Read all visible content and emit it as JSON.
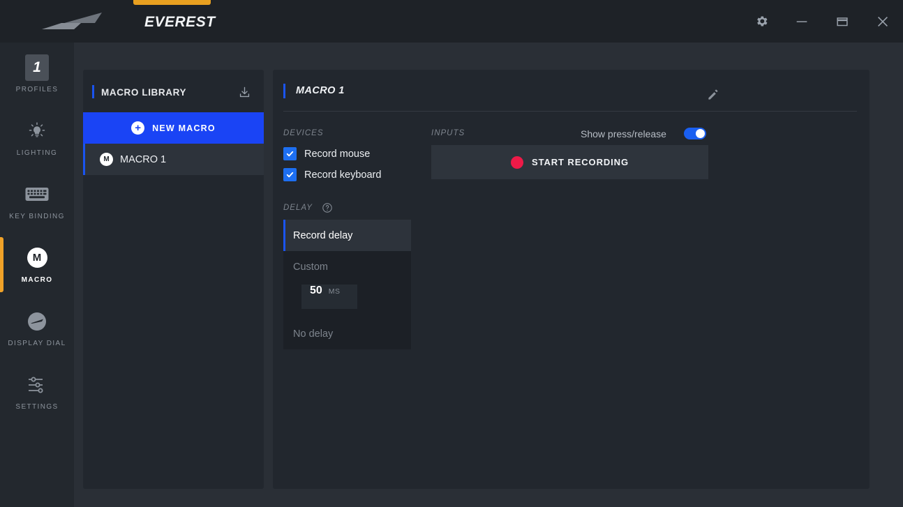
{
  "titlebar": {
    "app_title": "EVEREST",
    "logo_icon": "everest-logo-icon",
    "settings_icon": "gear-icon",
    "minimize_icon": "minimize-icon",
    "restore_icon": "restore-icon",
    "close_icon": "close-icon",
    "accent_color": "#e8a020"
  },
  "nav": {
    "items": [
      {
        "label": "PROFILES",
        "icon": "profile-number-icon",
        "value": "1",
        "active": false
      },
      {
        "label": "LIGHTING",
        "icon": "lightbulb-icon",
        "active": false
      },
      {
        "label": "KEY BINDING",
        "icon": "keyboard-icon",
        "active": false
      },
      {
        "label": "MACRO",
        "icon": "macro-m-icon",
        "value": "M",
        "active": true
      },
      {
        "label": "DISPLAY DIAL",
        "icon": "dial-icon",
        "active": false
      },
      {
        "label": "SETTINGS",
        "icon": "sliders-icon",
        "active": false
      }
    ],
    "active_color": "#f0a228"
  },
  "library": {
    "title": "MACRO LIBRARY",
    "import_icon": "download-icon",
    "new_macro_label": "NEW MACRO",
    "new_macro_icon": "plus-circle-icon",
    "accent_color": "#1a44f5",
    "macros": [
      {
        "name": "MACRO 1",
        "badge": "M",
        "selected": true
      }
    ]
  },
  "main": {
    "title": "MACRO 1",
    "edit_icon": "pencil-icon",
    "devices": {
      "label": "DEVICES",
      "options": [
        {
          "label": "Record mouse",
          "checked": true
        },
        {
          "label": "Record keyboard",
          "checked": true
        }
      ]
    },
    "inputs": {
      "label": "INPUTS",
      "press_release_label": "Show press/release",
      "press_release_on": true,
      "record_button_label": "START RECORDING",
      "record_dot_color": "#ee1a48"
    },
    "delay": {
      "label": "DELAY",
      "help_icon": "help-circle-icon",
      "options": [
        {
          "label": "Record delay",
          "selected": true
        },
        {
          "label": "Custom",
          "selected": false
        },
        {
          "label": "No delay",
          "selected": false
        }
      ],
      "custom_value": "50",
      "custom_unit": "MS"
    }
  }
}
